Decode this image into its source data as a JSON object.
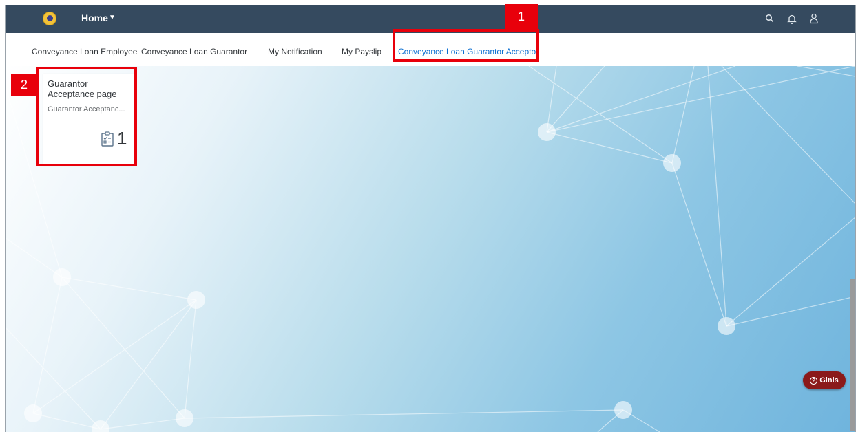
{
  "shell": {
    "home_label": "Home",
    "icons": [
      "search-icon",
      "bell-icon",
      "user-icon"
    ]
  },
  "tabs": [
    {
      "label": "Conveyance Loan Employee",
      "active": false
    },
    {
      "label": "Conveyance Loan Guarantor",
      "active": false
    },
    {
      "label": "My Notification",
      "active": false
    },
    {
      "label": "My Payslip",
      "active": false
    },
    {
      "label": "Conveyance Loan Guarantor Acceptor",
      "active": true
    }
  ],
  "tile": {
    "title": "Guarantor Acceptance page",
    "subtitle": "Guarantor Acceptanc...",
    "count": "1",
    "icon": "clipboard-checklist-icon"
  },
  "annotations": [
    {
      "label": "1"
    },
    {
      "label": "2"
    }
  ],
  "ginis": {
    "label": "Ginis",
    "icon": "help-circle-icon"
  },
  "colors": {
    "shellbar": "#354a5f",
    "active_tab": "#0a6ed1",
    "annotation_red": "#e8000b",
    "ginis_button": "#8b1a1a"
  }
}
